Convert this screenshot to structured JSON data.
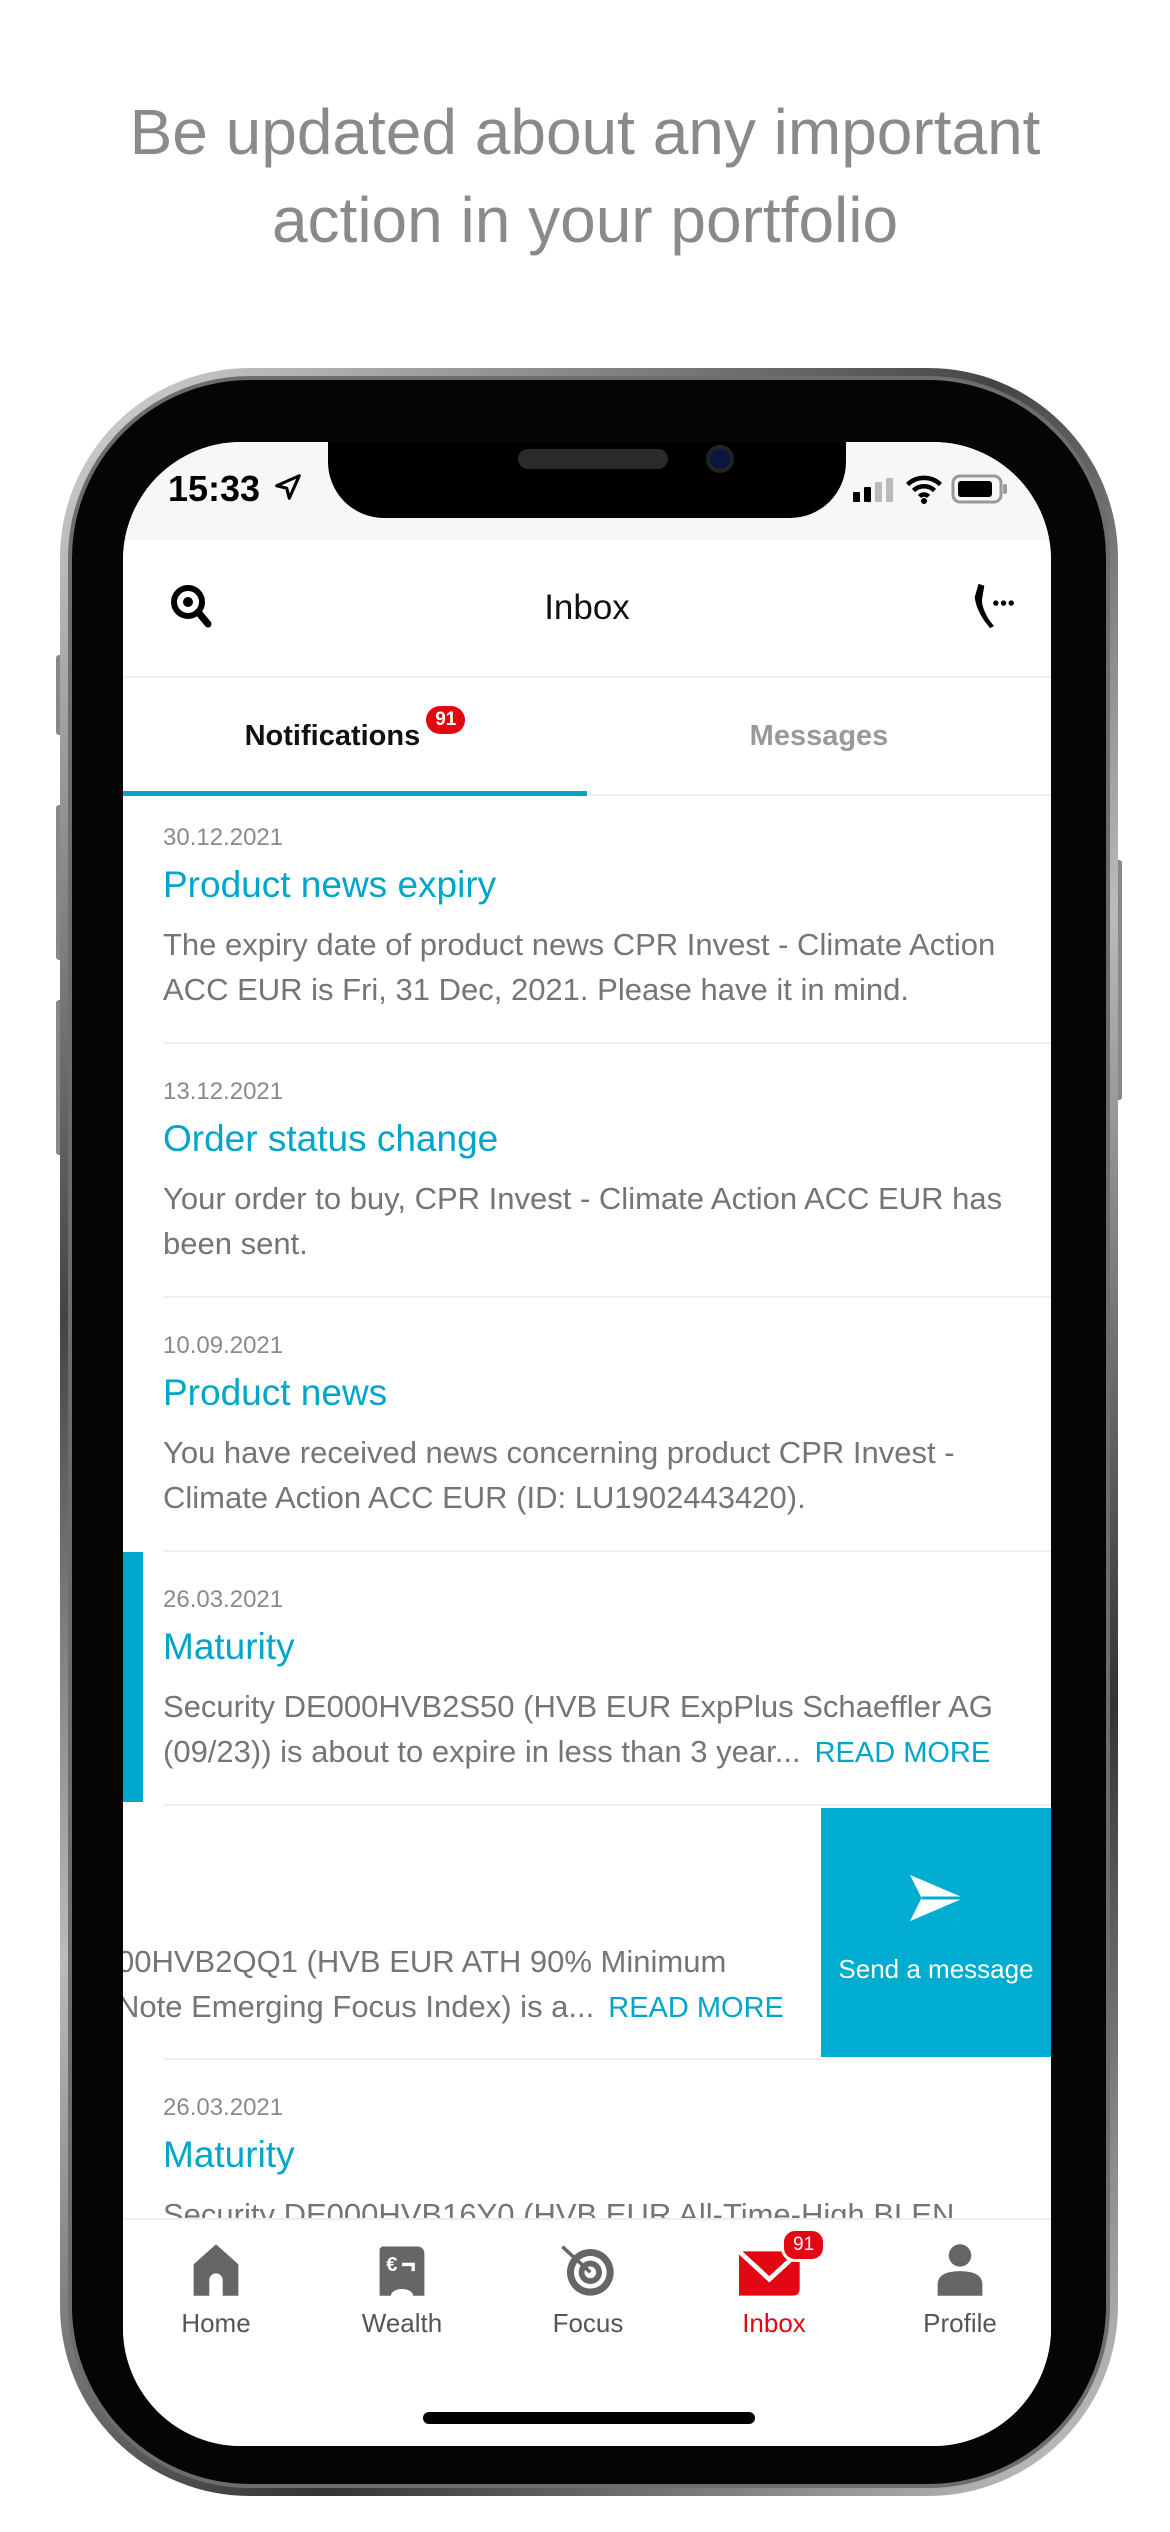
{
  "headline": [
    "Be updated about any important",
    "action in your portfolio"
  ],
  "status_bar": {
    "time": "15:33"
  },
  "header": {
    "title": "Inbox",
    "left_icon": "search-icon",
    "right_icon": "phone-icon"
  },
  "tabs": [
    {
      "label": "Notifications",
      "badge": "91",
      "active": true
    },
    {
      "label": "Messages",
      "active": false
    }
  ],
  "notifications": [
    {
      "date": "30.12.2021",
      "title": "Product news expiry",
      "body": "The expiry date of product news CPR Invest - Climate Action ACC EUR is Fri, 31 Dec, 2021. Please have it in mind."
    },
    {
      "date": "13.12.2021",
      "title": "Order status change",
      "body": "Your order to buy, CPR Invest - Climate Action ACC EUR has been sent."
    },
    {
      "date": "10.09.2021",
      "title": "Product news",
      "body": "You have received news concerning product CPR Invest - Climate Action ACC EUR (ID: LU1902443420)."
    },
    {
      "date": "26.03.2021",
      "title": "Maturity",
      "body": "Security DE000HVB2S50 (HVB EUR ExpPlus Schaeffler AG (09/23)) is about to expire in less than 3 year...",
      "read_more": "READ MORE"
    },
    {
      "body_line1": "00HVB2QQ1 (HVB EUR ATH  90% Minimum",
      "body_line2": "Note Emerging Focus Index) is a...",
      "read_more": "READ MORE",
      "swipe_action": "Send a message"
    },
    {
      "date": "26.03.2021",
      "title": "Maturity",
      "body": "Security DE000HVB16Y0 (HVB EUR All-Time-High BLEN"
    }
  ],
  "bottom_nav": [
    {
      "label": "Home",
      "icon": "home-icon"
    },
    {
      "label": "Wealth",
      "icon": "wealth-icon"
    },
    {
      "label": "Focus",
      "icon": "target-icon"
    },
    {
      "label": "Inbox",
      "icon": "mail-icon",
      "badge": "91",
      "active": true
    },
    {
      "label": "Profile",
      "icon": "person-icon"
    }
  ],
  "colors": {
    "accent": "#00a5cb",
    "badge": "#e30613",
    "text_muted": "#757575"
  }
}
